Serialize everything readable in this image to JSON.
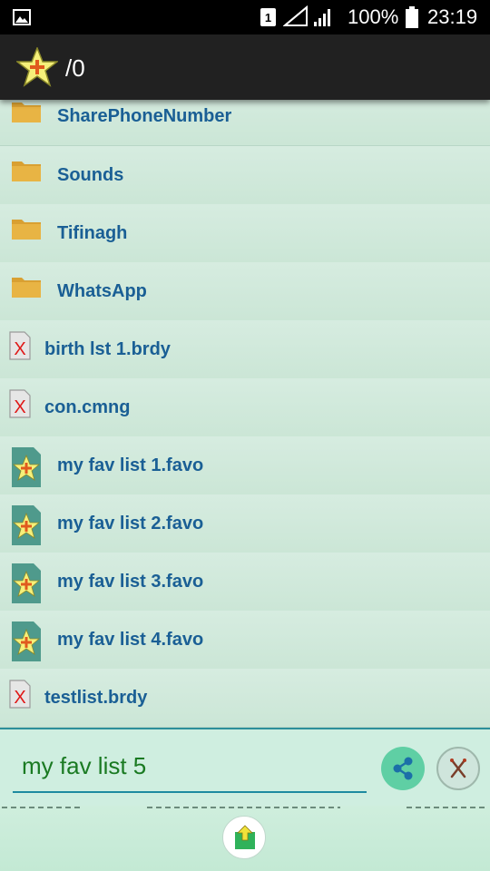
{
  "status_bar": {
    "battery_percent": "100%",
    "time": "23:19",
    "sim_slot": "1"
  },
  "app_bar": {
    "path": "/0"
  },
  "files": [
    {
      "name": "SharePhoneNumber",
      "icon": "folder-icon"
    },
    {
      "name": "Sounds",
      "icon": "folder-icon"
    },
    {
      "name": "Tifinagh",
      "icon": "folder-icon"
    },
    {
      "name": "WhatsApp",
      "icon": "folder-icon"
    },
    {
      "name": "birth lst 1.brdy",
      "icon": "unknown-file-icon"
    },
    {
      "name": "con.cmng",
      "icon": "unknown-file-icon"
    },
    {
      "name": "my fav list 1.favo",
      "icon": "favorite-file-icon"
    },
    {
      "name": "my fav list 2.favo",
      "icon": "favorite-file-icon"
    },
    {
      "name": "my fav list 3.favo",
      "icon": "favorite-file-icon"
    },
    {
      "name": "my fav list 4.favo",
      "icon": "favorite-file-icon"
    },
    {
      "name": "testlist.brdy",
      "icon": "unknown-file-icon"
    }
  ],
  "filename_input": {
    "value": "my fav list 5"
  },
  "colors": {
    "accent": "#1e8aa0",
    "folder": "#d9a032",
    "item_text": "#1a5f95",
    "input_text": "#1a7a22"
  }
}
